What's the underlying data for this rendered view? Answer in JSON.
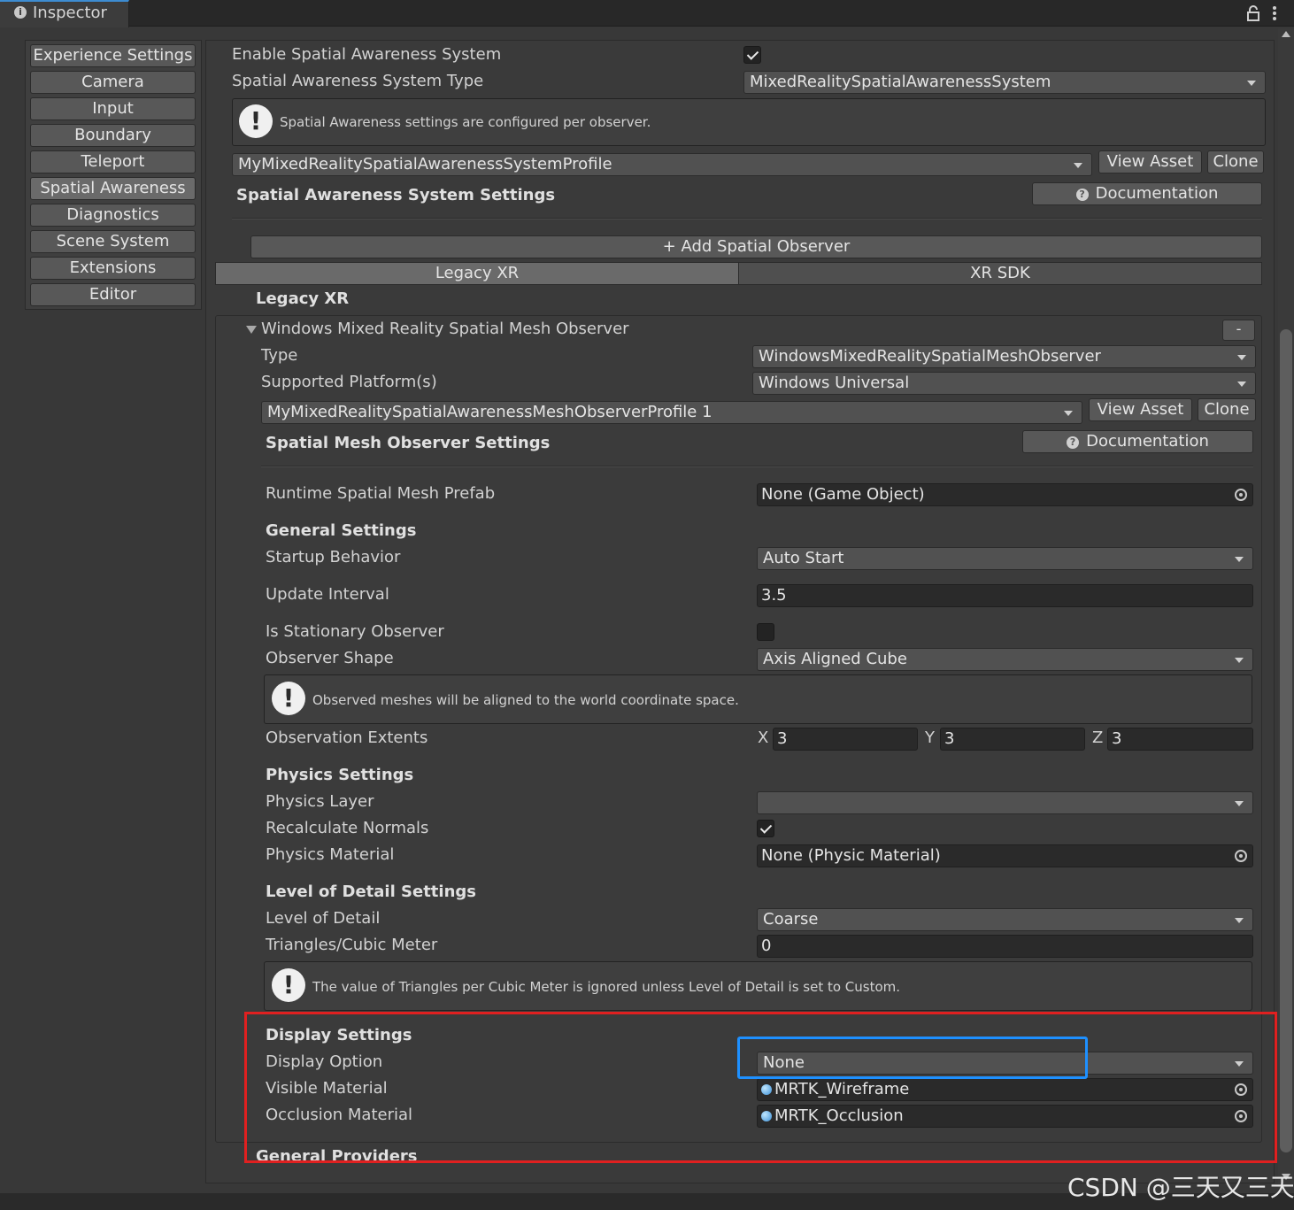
{
  "window": {
    "tab_title": "Inspector",
    "tab_icon": "info-icon"
  },
  "sidebar": {
    "items": [
      {
        "label": "Experience Settings"
      },
      {
        "label": "Camera"
      },
      {
        "label": "Input"
      },
      {
        "label": "Boundary"
      },
      {
        "label": "Teleport"
      },
      {
        "label": "Spatial Awareness",
        "active": true
      },
      {
        "label": "Diagnostics"
      },
      {
        "label": "Scene System"
      },
      {
        "label": "Extensions"
      },
      {
        "label": "Editor"
      }
    ]
  },
  "system": {
    "enable_label": "Enable Spatial Awareness System",
    "enable_checked": true,
    "type_label": "Spatial Awareness System Type",
    "type_value": "MixedRealitySpatialAwarenessSystem",
    "info_text": "Spatial Awareness settings are configured per observer.",
    "profile_value": "MyMixedRealitySpatialAwarenessSystemProfile",
    "view_asset": "View Asset",
    "clone": "Clone",
    "settings_header": "Spatial Awareness System Settings",
    "documentation": "Documentation",
    "add_observer": "+ Add Spatial Observer"
  },
  "tabs": {
    "legacy": "Legacy XR",
    "sdk": "XR SDK",
    "section_title": "Legacy XR"
  },
  "observer": {
    "title": "Windows Mixed Reality Spatial Mesh Observer",
    "remove": "-",
    "type_label": "Type",
    "type_value": "WindowsMixedRealitySpatialMeshObserver",
    "platforms_label": "Supported Platform(s)",
    "platforms_value": "Windows Universal",
    "profile_value": "MyMixedRealitySpatialAwarenessMeshObserverProfile 1",
    "view_asset": "View Asset",
    "clone": "Clone",
    "settings_header": "Spatial Mesh Observer Settings",
    "documentation": "Documentation",
    "prefab_label": "Runtime Spatial Mesh Prefab",
    "prefab_value": "None (Game Object)",
    "general_header": "General Settings",
    "startup_label": "Startup Behavior",
    "startup_value": "Auto Start",
    "interval_label": "Update Interval",
    "interval_value": "3.5",
    "stationary_label": "Is Stationary Observer",
    "stationary_checked": false,
    "shape_label": "Observer Shape",
    "shape_value": "Axis Aligned Cube",
    "shape_info": "Observed meshes will be aligned to the world coordinate space.",
    "extents_label": "Observation Extents",
    "extents": {
      "x_label": "X",
      "x": "3",
      "y_label": "Y",
      "y": "3",
      "z_label": "Z",
      "z": "3"
    },
    "physics_header": "Physics Settings",
    "physics_layer_label": "Physics Layer",
    "physics_layer_value": "",
    "normals_label": "Recalculate Normals",
    "normals_checked": true,
    "physics_material_label": "Physics Material",
    "physics_material_value": "None (Physic Material)",
    "lod_header": "Level of Detail Settings",
    "lod_label": "Level of Detail",
    "lod_value": "Coarse",
    "triangles_label": "Triangles/Cubic Meter",
    "triangles_value": "0",
    "lod_info": "The value of Triangles per Cubic Meter is ignored unless Level of Detail is set to Custom.",
    "display_header": "Display Settings",
    "display_option_label": "Display Option",
    "display_option_value": "None",
    "visible_material_label": "Visible Material",
    "visible_material_value": "MRTK_Wireframe",
    "occlusion_material_label": "Occlusion Material",
    "occlusion_material_value": "MRTK_Occlusion"
  },
  "footer": {
    "general_providers": "General Providers"
  },
  "watermark": "CSDN @三天又三天",
  "colors": {
    "highlight_red": "#e02020",
    "highlight_blue": "#1e90ff",
    "panel_bg": "#383838"
  }
}
